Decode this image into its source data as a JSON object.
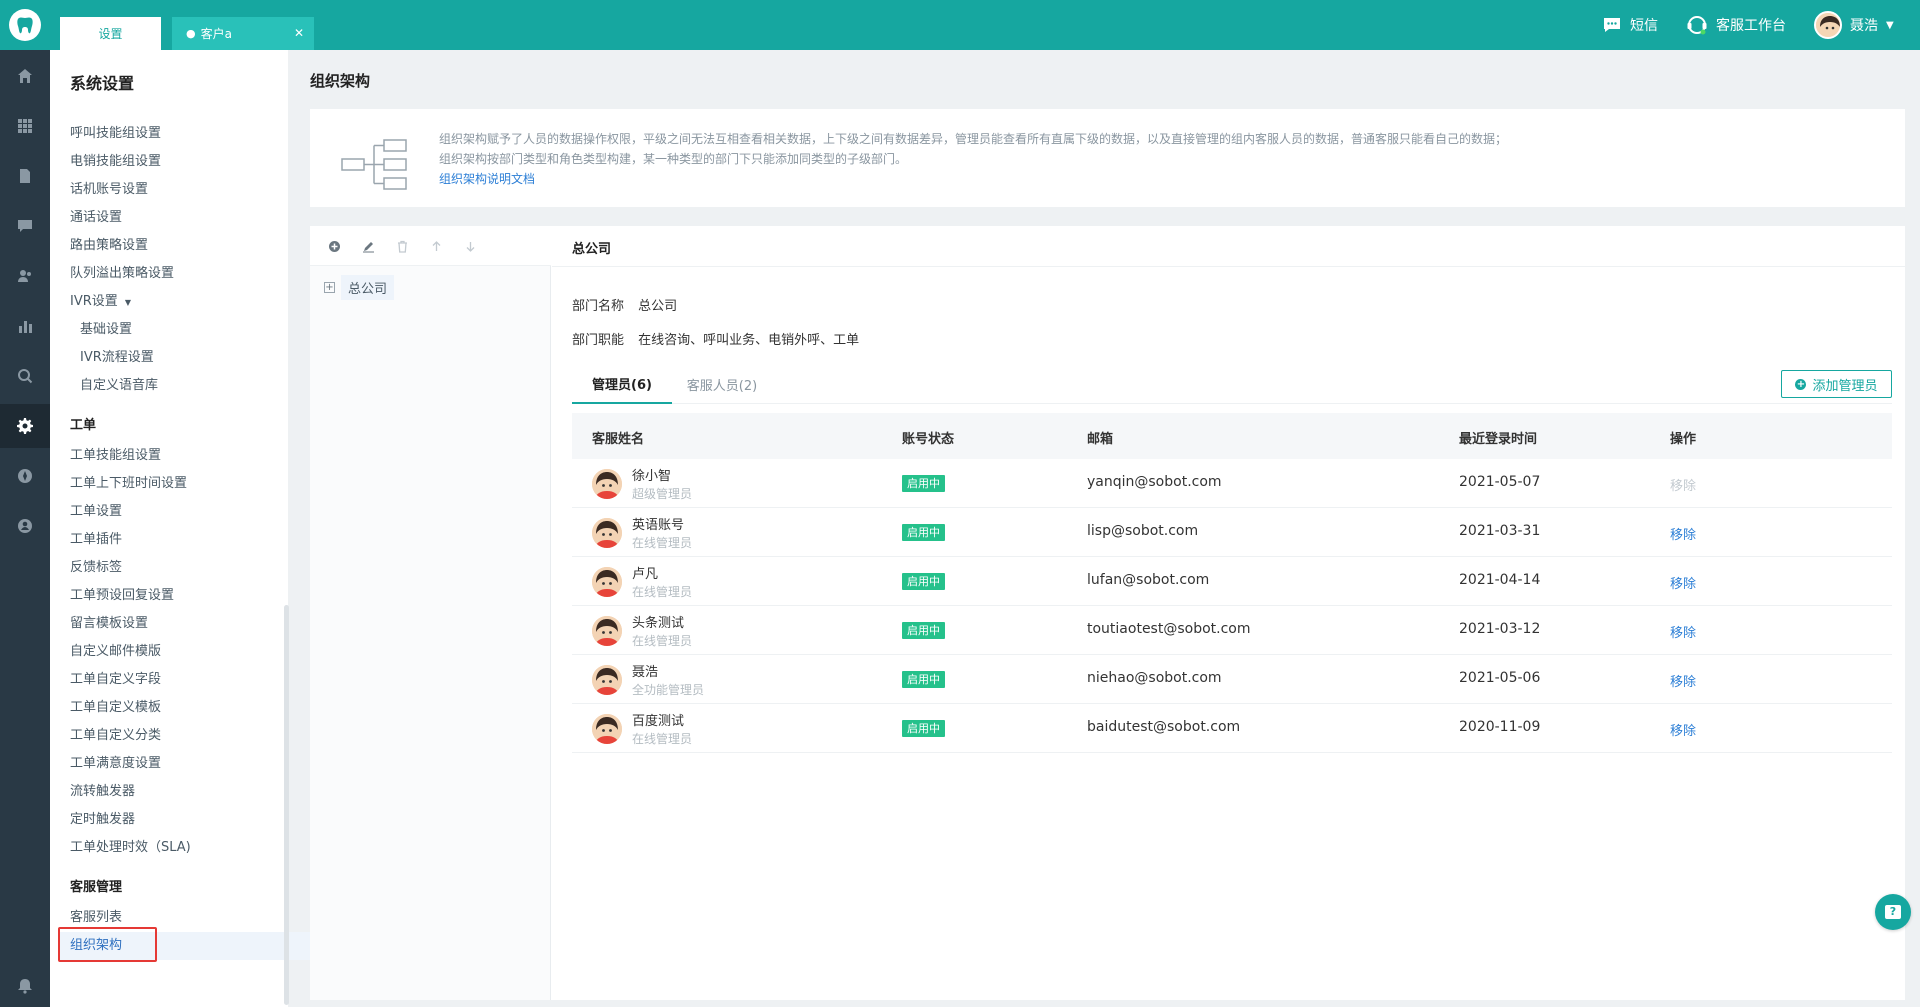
{
  "tabs": [
    {
      "label": "设置"
    },
    {
      "label": "客户a"
    }
  ],
  "topbar": {
    "sms_label": "短信",
    "workbench_label": "客服工作台",
    "user_name": "聂浩"
  },
  "sidebar": {
    "title": "系统设置",
    "items_top": [
      "呼叫技能组设置",
      "电销技能组设置",
      "话机账号设置",
      "通话设置",
      "路由策略设置",
      "队列溢出策略设置"
    ],
    "ivr_label": "IVR设置",
    "ivr_children": [
      "基础设置",
      "IVR流程设置",
      "自定义语音库"
    ],
    "ticket_head": "工单",
    "ticket_items": [
      "工单技能组设置",
      "工单上下班时间设置",
      "工单设置",
      "工单插件",
      "反馈标签",
      "工单预设回复设置",
      "留言模板设置",
      "自定义邮件模版",
      "工单自定义字段",
      "工单自定义模板",
      "工单自定义分类",
      "工单满意度设置",
      "流转触发器",
      "定时触发器",
      "工单处理时效（SLA)"
    ],
    "staff_head": "客服管理",
    "staff_items": [
      "客服列表",
      "组织架构"
    ]
  },
  "main": {
    "page_title": "组织架构",
    "intro_line1": "组织架构赋予了人员的数据操作权限，平级之间无法互相查看相关数据，上下级之间有数据差异，管理员能查看所有直属下级的数据，以及直接管理的组内客服人员的数据，普通客服只能看自己的数据；",
    "intro_line2": "组织架构按部门类型和角色类型构建，某一种类型的部门下只能添加同类型的子级部门。",
    "intro_link": "组织架构说明文档"
  },
  "tree": {
    "root_label": "总公司"
  },
  "detail": {
    "title": "总公司",
    "dept_name_label": "部门名称",
    "dept_name": "总公司",
    "dept_func_label": "部门职能",
    "dept_func": "在线咨询、呼叫业务、电销外呼、工单",
    "tab_admin": "管理员(6)",
    "tab_staff": "客服人员(2)",
    "add_button": "添加管理员"
  },
  "table": {
    "headers": [
      "客服姓名",
      "账号状态",
      "邮箱",
      "最近登录时间",
      "操作"
    ],
    "rows": [
      {
        "name": "徐小智",
        "role": "超级管理员",
        "status": "启用中",
        "email": "yanqin@sobot.com",
        "date": "2021-05-07",
        "op": "移除"
      },
      {
        "name": "英语账号",
        "role": "在线管理员",
        "status": "启用中",
        "email": "lisp@sobot.com",
        "date": "2021-03-31",
        "op": "移除"
      },
      {
        "name": "卢凡",
        "role": "在线管理员",
        "status": "启用中",
        "email": "lufan@sobot.com",
        "date": "2021-04-14",
        "op": "移除"
      },
      {
        "name": "头条测试",
        "role": "在线管理员",
        "status": "启用中",
        "email": "toutiaotest@sobot.com",
        "date": "2021-03-12",
        "op": "移除"
      },
      {
        "name": "聂浩",
        "role": "全功能管理员",
        "status": "启用中",
        "email": "niehao@sobot.com",
        "date": "2021-05-06",
        "op": "移除"
      },
      {
        "name": "百度测试",
        "role": "在线管理员",
        "status": "启用中",
        "email": "baidutest@sobot.com",
        "date": "2020-11-09",
        "op": "移除"
      }
    ]
  },
  "colors": {
    "brand": "#16a7a0",
    "status_green": "#25c18b",
    "link_blue": "#2d7fd6"
  }
}
